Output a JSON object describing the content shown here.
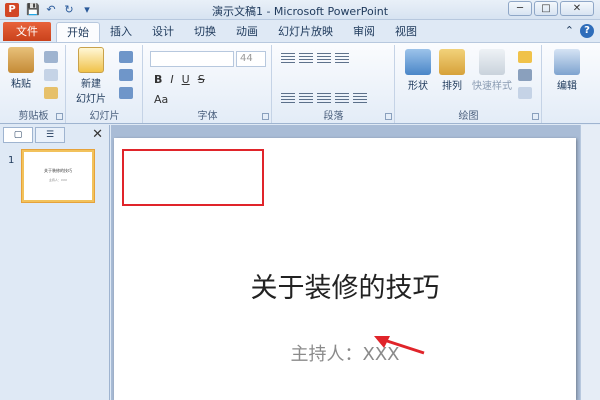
{
  "titlebar": {
    "app_icon_letter": "P",
    "title": "演示文稿1 - Microsoft PowerPoint",
    "minimize": "─",
    "maximize": "□",
    "close": "✕"
  },
  "tabs": {
    "file": "文件",
    "items": [
      "开始",
      "插入",
      "设计",
      "切换",
      "动画",
      "幻灯片放映",
      "审阅",
      "视图"
    ],
    "active": "开始"
  },
  "ribbon": {
    "clipboard": {
      "paste": "粘贴",
      "label": "剪贴板"
    },
    "slides": {
      "new_slide_line1": "新建",
      "new_slide_line2": "幻灯片",
      "label": "幻灯片"
    },
    "font": {
      "size": "44",
      "label": "字体",
      "bold": "B",
      "italic": "I",
      "underline": "U",
      "strike": "S",
      "size_text": "Aa"
    },
    "paragraph": {
      "label": "段落"
    },
    "drawing": {
      "shapes": "形状",
      "arrange": "排列",
      "quick_styles": "快速样式",
      "label": "绘图"
    },
    "editing": {
      "edit": "编辑"
    }
  },
  "slide_pane": {
    "tab1": "▢",
    "tab2": "☰",
    "close": "✕",
    "thumb_number": "1",
    "thumb_title": "关于装修的技巧",
    "thumb_sub": "主持人：XXX"
  },
  "slide": {
    "title": "关于装修的技巧",
    "subtitle": "主持人：XXX"
  },
  "colors": {
    "highlight_box": "#e0242a",
    "file_tab": "#d24726"
  }
}
